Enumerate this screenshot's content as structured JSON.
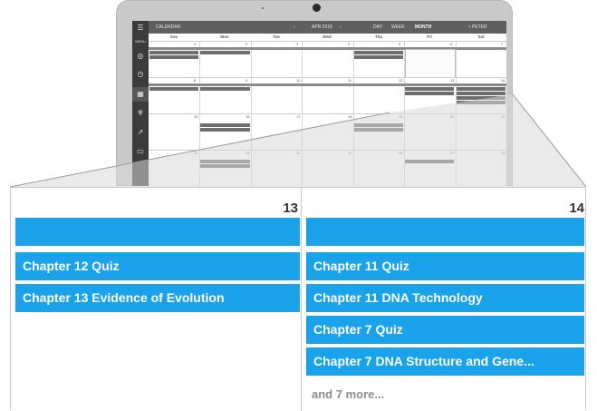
{
  "app": {
    "menu_label": "MENU",
    "section_title": "CALENDAR",
    "month_label": "APR 2018",
    "prev_icon": "chevron-left-icon",
    "next_icon": "chevron-right-icon",
    "views": [
      "DAY",
      "WEEK",
      "MONTH"
    ],
    "active_view": "MONTH",
    "user_name": "PETER",
    "sidebar_icons": [
      "menu-icon",
      "user-icon",
      "clock-icon",
      "calendar-icon",
      "trophy-icon",
      "chart-icon",
      "save-icon"
    ]
  },
  "weekdays": [
    "Sun",
    "Mon",
    "Tue",
    "Wed",
    "Thu",
    "Fri",
    "Sat"
  ],
  "weeks": [
    {
      "days": [
        "1",
        "2",
        "3",
        "4",
        "5",
        "6",
        "7"
      ]
    },
    {
      "days": [
        "8",
        "9",
        "10",
        "11",
        "12",
        "13",
        "14"
      ]
    },
    {
      "days": [
        "15",
        "16",
        "17",
        "18",
        "19",
        "20",
        "21"
      ]
    },
    {
      "days": [
        "22",
        "23",
        "24",
        "25",
        "26",
        "27",
        "28"
      ]
    }
  ],
  "zoom": {
    "left_day": {
      "number": "13",
      "events": [
        "",
        "Chapter 12 Quiz",
        "Chapter 13 Evidence of Evolution"
      ]
    },
    "right_day": {
      "number": "14",
      "events": [
        "",
        "Chapter 11 Quiz",
        "Chapter 11 DNA Technology",
        "Chapter 7 Quiz",
        "Chapter 7 DNA Structure and Gene..."
      ],
      "more": "and 7 more..."
    }
  },
  "colors": {
    "event_blue": "#1aa3ea",
    "topbar": "#5f5f5f",
    "sidebar": "#3b3b3b"
  }
}
